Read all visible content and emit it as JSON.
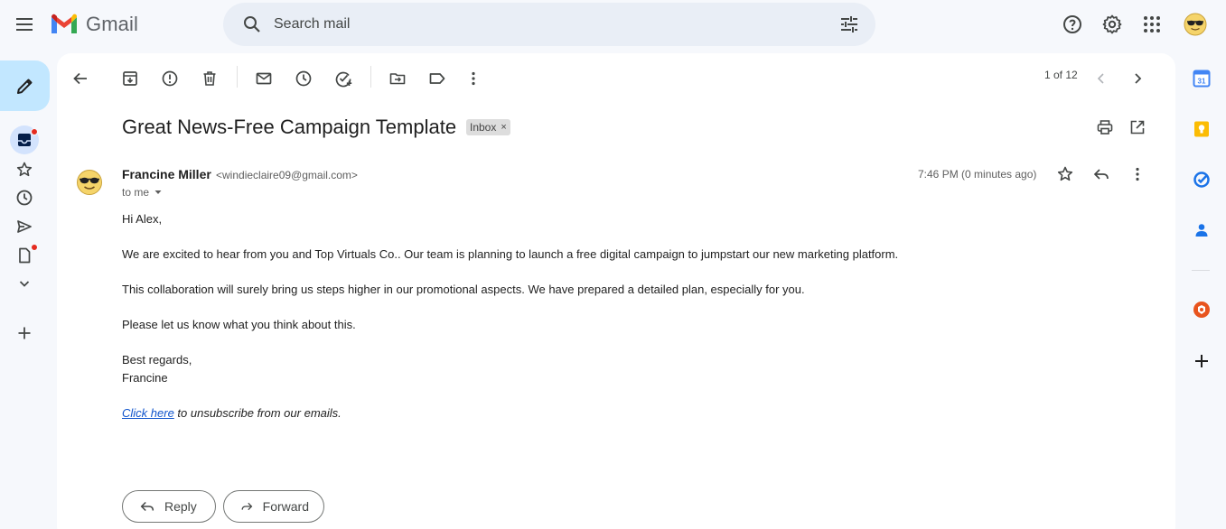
{
  "app": {
    "name": "Gmail"
  },
  "header": {
    "search_placeholder": "Search mail",
    "icons": [
      "menu-icon",
      "search-icon",
      "tune-icon",
      "help-icon",
      "gear-icon",
      "apps-icon",
      "avatar"
    ]
  },
  "rail": {
    "items": [
      "inbox-icon",
      "star-icon",
      "clock-icon",
      "send-icon",
      "draft-icon",
      "chevron-down-icon",
      "plus-icon"
    ]
  },
  "toolbar": {
    "page_count": "1 of 12"
  },
  "email": {
    "subject": "Great News-Free Campaign Template",
    "label": "Inbox",
    "label_remove": "×",
    "sender_name": "Francine Miller",
    "sender_email": "<windieclaire09@gmail.com>",
    "to_line": "to me",
    "timestamp": "7:46 PM (0 minutes ago)",
    "body": {
      "greeting": "Hi Alex,",
      "p1": "We are excited to hear from you and Top Virtuals Co.. Our team is planning to launch a free digital campaign to jumpstart our new marketing platform.",
      "p2": "This collaboration will surely bring us steps higher in our promotional aspects. We have prepared a detailed plan, especially for you.",
      "p3": "Please let us know what you think about this.",
      "signoff": "Best regards,",
      "signature": "Francine",
      "unsub_link": "Click here",
      "unsub_text": " to unsubscribe from our emails."
    }
  },
  "actions": {
    "reply_label": "Reply",
    "forward_label": "Forward"
  },
  "side_panel": {
    "calendar_day": "31",
    "apps": [
      "calendar-icon",
      "keep-icon",
      "tasks-icon",
      "contacts-icon",
      "addon-icon",
      "plus-icon"
    ]
  },
  "colors": {
    "background": "#f6f8fc",
    "compose": "#c2e7ff",
    "search_bg": "#e9eef6",
    "link": "#1155cc",
    "badge_red": "#e52b20"
  }
}
